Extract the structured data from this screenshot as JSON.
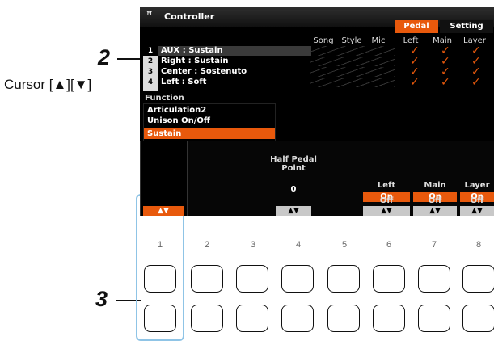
{
  "callouts": {
    "step2": "2",
    "step3": "3",
    "cursor": "Cursor [▲][▼]"
  },
  "screen": {
    "title": "Controller",
    "title_icon": "pedal-icon",
    "tabs": [
      "Pedal",
      "Setting"
    ],
    "columns": [
      "Song",
      "Style",
      "Mic",
      "Left",
      "Main",
      "Layer"
    ],
    "pedals": [
      {
        "index": "1",
        "name": "AUX : Sustain",
        "left": "✓",
        "main": "✓",
        "layer": "✓"
      },
      {
        "index": "2",
        "name": "Right : Sustain",
        "left": "✓",
        "main": "✓",
        "layer": "✓"
      },
      {
        "index": "3",
        "name": "Center : Sostenuto",
        "left": "✓",
        "main": "✓",
        "layer": "✓"
      },
      {
        "index": "4",
        "name": "Left : Soft",
        "left": "✓",
        "main": "✓",
        "layer": "✓"
      }
    ],
    "function_label": "Function",
    "functions": [
      "Articulation2",
      "Unison On/Off",
      "Sustain"
    ],
    "selected_function": "Sustain",
    "half_pedal": {
      "label_line1": "Half Pedal",
      "label_line2": "Point",
      "value": "0",
      "arrows": "▲▼"
    },
    "parts": [
      {
        "label": "Left",
        "on": "On",
        "off": "Off",
        "arrows": "▲▼"
      },
      {
        "label": "Main",
        "on": "On",
        "off": "Off",
        "arrows": "▲▼"
      },
      {
        "label": "Layer",
        "on": "On",
        "off": "Off",
        "arrows": "▲▼"
      }
    ],
    "col1_arrows": "▲▼"
  },
  "buttons": {
    "numbers": [
      "1",
      "2",
      "3",
      "4",
      "5",
      "6",
      "7",
      "8"
    ]
  },
  "colors": {
    "accent": "#e8590c",
    "bracket": "#8fc4e6"
  }
}
